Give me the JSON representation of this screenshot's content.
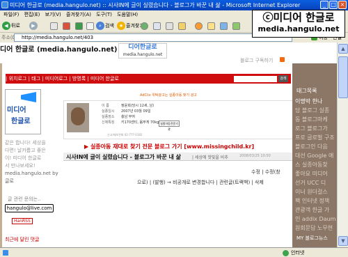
{
  "window": {
    "title": "미디어 한글로 (media.hangulo.net) :: 시사IN에 글이 실렸습니다 - 블로그가 바꾼 내 삶 - Microsoft Internet Explorer"
  },
  "watermark": {
    "line1": "ⓒ미디어 한글로",
    "line2": "media.hangulo.net"
  },
  "menu": [
    "파일(F)",
    "편집(E)",
    "보기(V)",
    "즐겨찾기(A)",
    "도구(T)",
    "도움말(H)"
  ],
  "toolbar": {
    "back": "뒤로",
    "search": "검색",
    "favorites": "즐겨찾기"
  },
  "address": {
    "label": "주소(D)",
    "url": "http://media.hangulo.net/403",
    "go": "이동",
    "links": "연결"
  },
  "blog": {
    "title": "디어 한글로 (media.hangulo.net)",
    "logo_main": "디어한글로",
    "logo_url": "media.hangulo.net",
    "subscribe": "블로그 구독하기"
  },
  "nav": {
    "text": "| 위치로그 | 태그 | 미디어로그 | 방명록    |    미디어 한글로",
    "search_button": "검색"
  },
  "profile": {
    "image_line1": "미디어",
    "image_line2": "한글로",
    "text1": "같은 합니다! 세상을",
    "text2": "다면! 날카롭고 좋은",
    "text3": "이! 미디어 한글로",
    "text4": "서 만나보세요!",
    "text5": "media.hangulo.net by",
    "text6": "글로",
    "related": "글 관련 문의는..",
    "email": "hangulo@live.com",
    "hanrss": "HanRSS",
    "comments": "최근에 달린 댓글"
  },
  "ad": {
    "label": "AdClix 위탁광고는 실종아동 찾기 광고",
    "rows": [
      {
        "k": "이 름",
        "v": "정윤희(당시 12세, 남)"
      },
      {
        "k": "실종일시",
        "v": "2007년 03월 09일"
      },
      {
        "k": "실종장소",
        "v": "충남 부여"
      },
      {
        "k": "신체특징",
        "v": "키170센티, 몸무게 70kg"
      }
    ],
    "org": "실종아동전문기관",
    "footer": "신고/제보전화 02-777-0182"
  },
  "post": {
    "missing_link": "▶ 실종아동 재대로 찾기 전문 블로그 가기 [www.missingchild.kr]",
    "title": "시사IN에 글이 실렸습니다 - 블로그가 바꾼 내 삶",
    "meta": "| 세상에 핫빛을 비추",
    "date": "2008/03/25 10:50",
    "edit": "수정 | 수정(창",
    "actions": "으로) | (발행) → 비공개로 변경합니다 | 관련글(트랙백) | 삭제"
  },
  "right_sidebar": {
    "title": "태그목록",
    "lines": [
      "이명박 한나",
      "당 블로그 실종",
      "동 블로그마케",
      "로그 블로그가",
      "프로 글로벌 구조",
      "블로그인 다음",
      "대선 Google 애",
      "스 실종아동찾",
      "좋아요 미디어",
      "선거 UCC 디",
      "이너 원더걸스",
      "팩 인터넷 정책",
      "관광객 한글 가",
      "인 addix Daum",
      "원회문답 노무현"
    ],
    "my_blog": "MY 블로그뉴스"
  },
  "status": {
    "zone": "인터넷"
  }
}
